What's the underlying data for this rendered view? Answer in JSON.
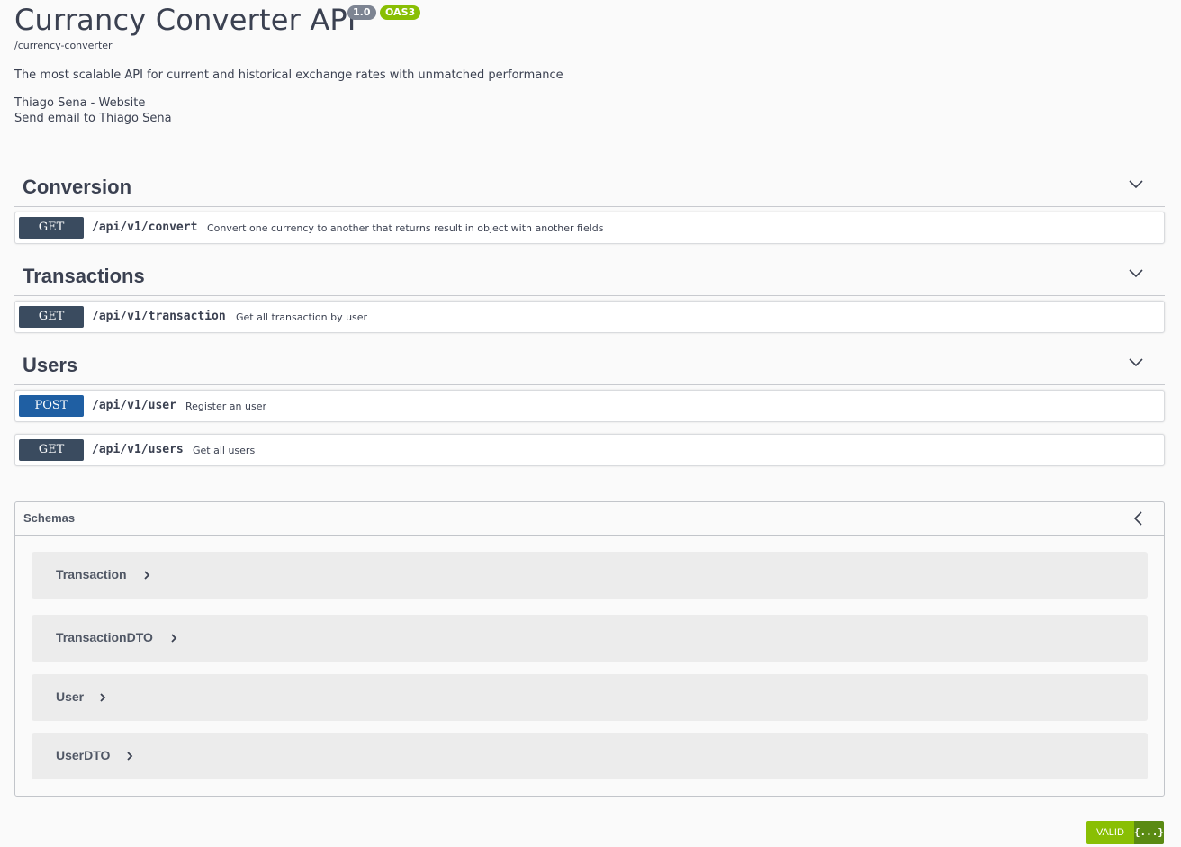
{
  "header": {
    "title": "Currancy Converter API",
    "version_badge": "1.0",
    "oas_badge": "OAS3",
    "base_url": "/currency-converter",
    "description": "The most scalable API for current and historical exchange rates with unmatched performance",
    "contact_website": "Thiago Sena - Website",
    "contact_email": "Send email to Thiago Sena"
  },
  "tags": [
    {
      "name": "Conversion",
      "operations": [
        {
          "method": "GET",
          "path": "/api/v1/convert",
          "summary": "Convert one currency to another that returns result in object with another fields"
        }
      ]
    },
    {
      "name": "Transactions",
      "operations": [
        {
          "method": "GET",
          "path": "/api/v1/transaction",
          "summary": "Get all transaction by user"
        }
      ]
    },
    {
      "name": "Users",
      "operations": [
        {
          "method": "POST",
          "path": "/api/v1/user",
          "summary": "Register an user"
        },
        {
          "method": "GET",
          "path": "/api/v1/users",
          "summary": "Get all users"
        }
      ]
    }
  ],
  "schemas": {
    "title": "Schemas",
    "models": [
      "Transaction",
      "TransactionDTO",
      "User",
      "UserDTO"
    ]
  },
  "validator": {
    "label": "VALID",
    "icon_text": "{...}"
  },
  "colors": {
    "get": "#3a4b5f",
    "post": "#1f5fa3",
    "oas": "#89bf04",
    "version": "#7d8492"
  }
}
